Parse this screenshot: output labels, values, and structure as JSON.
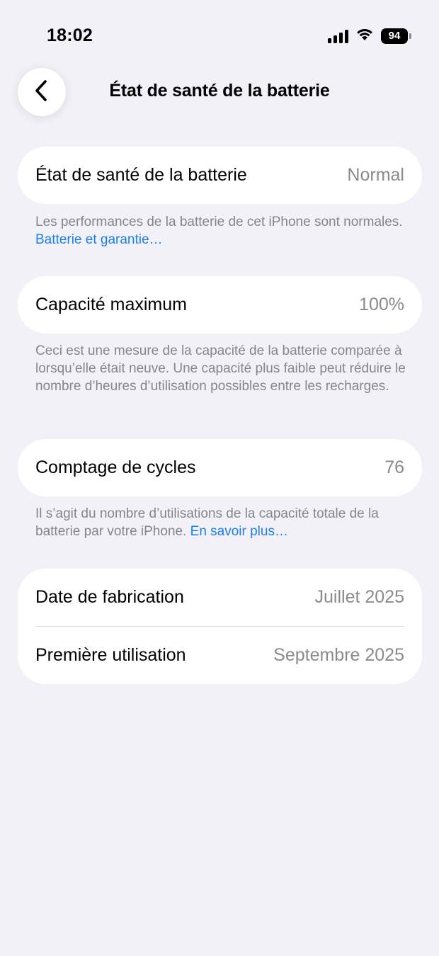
{
  "status_bar": {
    "time": "18:02",
    "battery_level": "94",
    "icons": [
      "cellular-signal-icon",
      "wifi-icon",
      "battery-icon"
    ]
  },
  "nav": {
    "back_icon": "chevron-left-icon",
    "title": "État de santé de la batterie"
  },
  "health": {
    "label": "État de santé de la batterie",
    "value": "Normal",
    "footnote": "Les performances de la batterie de cet iPhone sont normales.",
    "footnote_link": "Batterie et garantie…"
  },
  "capacity": {
    "label": "Capacité maximum",
    "value": "100%",
    "footnote": "Ceci est une mesure de la capacité de la batterie comparée à lorsqu’elle était neuve. Une capacité plus faible peut réduire le nombre d’heures d’utilisation possibles entre les recharges."
  },
  "cycles": {
    "label": "Comptage de cycles",
    "value": "76",
    "footnote": "Il s’agit du nombre d’utilisations de la capacité totale de la batterie par votre iPhone.",
    "footnote_link": "En savoir plus…"
  },
  "dates": {
    "manufacture_label": "Date de fabrication",
    "manufacture_value": "Juillet 2025",
    "first_use_label": "Première utilisation",
    "first_use_value": "Septembre 2025"
  },
  "colors": {
    "background": "#f2f1f7",
    "link": "#1a7ef0",
    "secondary_text": "#8a8a8e"
  }
}
